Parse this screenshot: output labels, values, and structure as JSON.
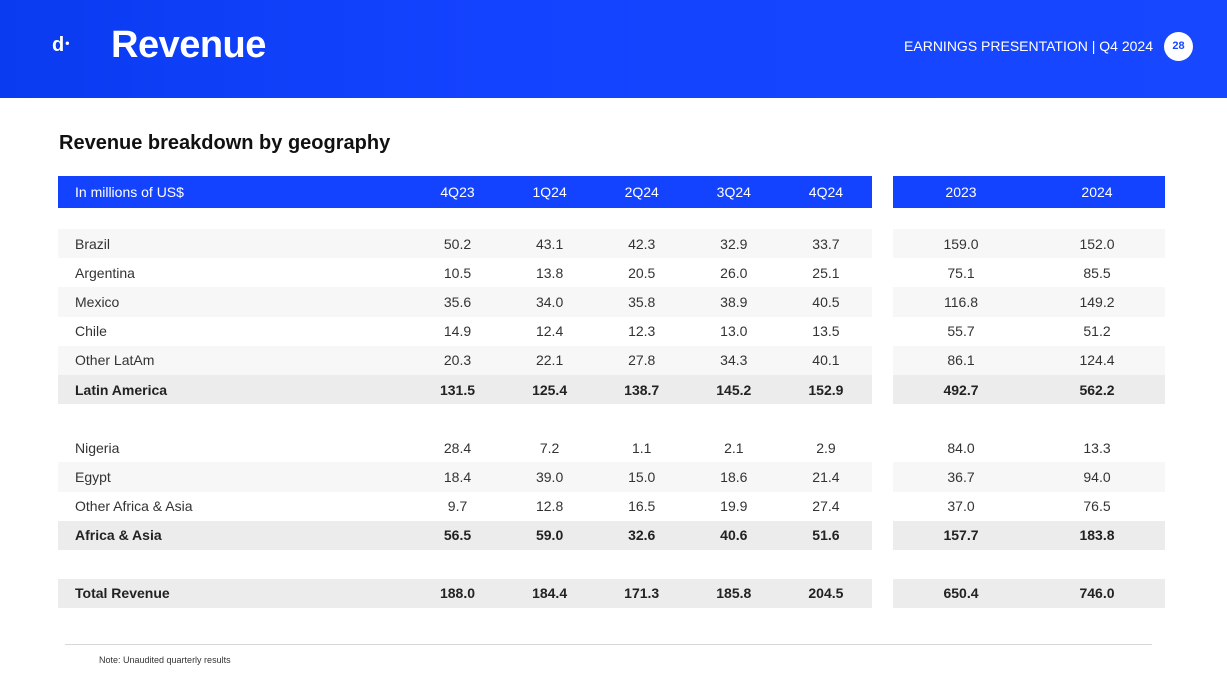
{
  "header": {
    "logo": "d",
    "title": "Revenue",
    "presentation": "EARNINGS PRESENTATION | Q4 2024",
    "page_number": "28"
  },
  "subtitle": "Revenue breakdown by geography",
  "table": {
    "unit_label": "In millions of US$",
    "quarters": [
      "4Q23",
      "1Q24",
      "2Q24",
      "3Q24",
      "4Q24"
    ],
    "years": [
      "2023",
      "2024"
    ],
    "rows": [
      {
        "label": "Brazil",
        "q": [
          "50.2",
          "43.1",
          "42.3",
          "32.9",
          "33.7"
        ],
        "y": [
          "159.0",
          "152.0"
        ]
      },
      {
        "label": "Argentina",
        "q": [
          "10.5",
          "13.8",
          "20.5",
          "26.0",
          "25.1"
        ],
        "y": [
          "75.1",
          "85.5"
        ]
      },
      {
        "label": "Mexico",
        "q": [
          "35.6",
          "34.0",
          "35.8",
          "38.9",
          "40.5"
        ],
        "y": [
          "116.8",
          "149.2"
        ]
      },
      {
        "label": "Chile",
        "q": [
          "14.9",
          "12.4",
          "12.3",
          "13.0",
          "13.5"
        ],
        "y": [
          "55.7",
          "51.2"
        ]
      },
      {
        "label": "Other LatAm",
        "q": [
          "20.3",
          "22.1",
          "27.8",
          "34.3",
          "40.1"
        ],
        "y": [
          "86.1",
          "124.4"
        ]
      },
      {
        "label": "Latin America",
        "q": [
          "131.5",
          "125.4",
          "138.7",
          "145.2",
          "152.9"
        ],
        "y": [
          "492.7",
          "562.2"
        ]
      },
      {
        "label": "Nigeria",
        "q": [
          "28.4",
          "7.2",
          "1.1",
          "2.1",
          "2.9"
        ],
        "y": [
          "84.0",
          "13.3"
        ]
      },
      {
        "label": "Egypt",
        "q": [
          "18.4",
          "39.0",
          "15.0",
          "18.6",
          "21.4"
        ],
        "y": [
          "36.7",
          "94.0"
        ]
      },
      {
        "label": "Other Africa & Asia",
        "q": [
          "9.7",
          "12.8",
          "16.5",
          "19.9",
          "27.4"
        ],
        "y": [
          "37.0",
          "76.5"
        ]
      },
      {
        "label": "Africa & Asia",
        "q": [
          "56.5",
          "59.0",
          "32.6",
          "40.6",
          "51.6"
        ],
        "y": [
          "157.7",
          "183.8"
        ]
      },
      {
        "label": "Total Revenue",
        "q": [
          "188.0",
          "184.4",
          "171.3",
          "185.8",
          "204.5"
        ],
        "y": [
          "650.4",
          "746.0"
        ]
      }
    ]
  },
  "note": "Note: Unaudited quarterly results"
}
